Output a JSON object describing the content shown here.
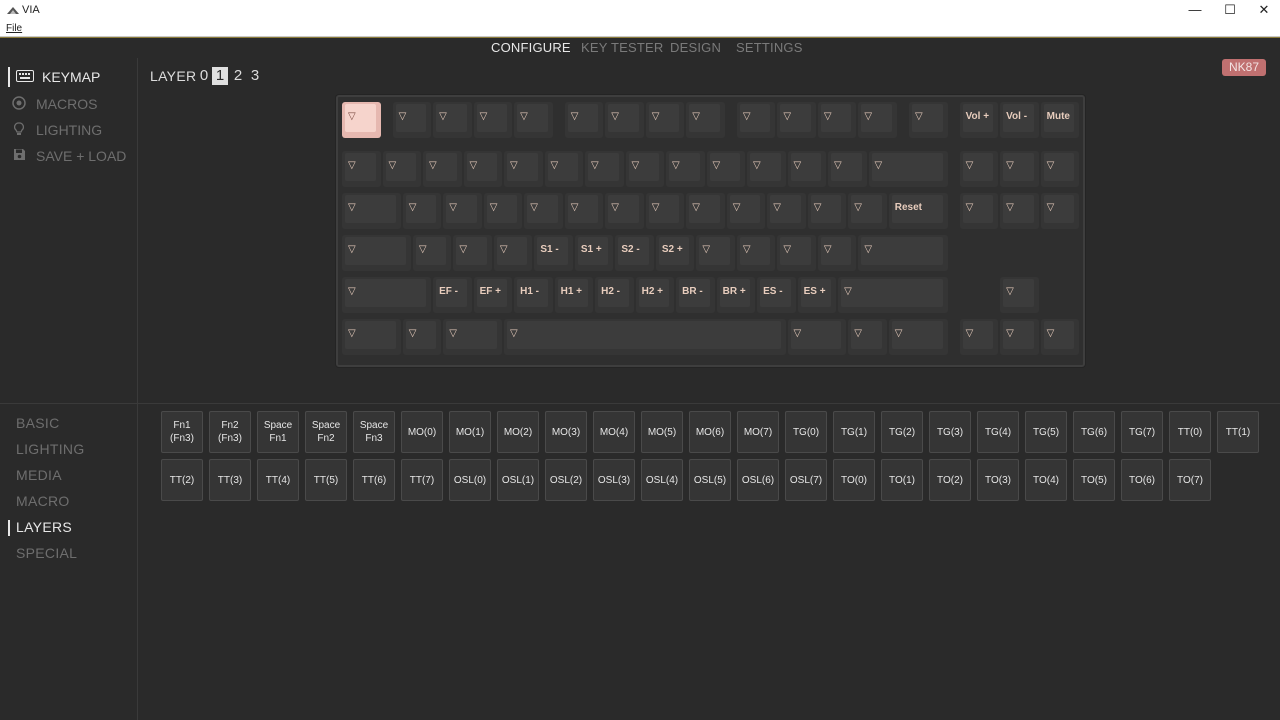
{
  "window": {
    "title": "VIA",
    "minimize": "—",
    "maximize": "☐",
    "close": "✕"
  },
  "menu": {
    "file": "File"
  },
  "topnav": {
    "tabs": [
      "CONFIGURE",
      "KEY TESTER",
      "DESIGN",
      "SETTINGS"
    ],
    "active": 0
  },
  "sidebar": {
    "items": [
      {
        "label": "KEYMAP",
        "icon": "keyboard-icon"
      },
      {
        "label": "MACROS",
        "icon": "macro-circle-icon"
      },
      {
        "label": "LIGHTING",
        "icon": "lightbulb-icon"
      },
      {
        "label": "SAVE + LOAD",
        "icon": "floppy-disk-icon"
      }
    ],
    "active": 0
  },
  "layer": {
    "label": "LAYER",
    "numbers": [
      "0",
      "1",
      "2",
      "3"
    ],
    "active": 1
  },
  "device_badge": "NK87",
  "keyboard": {
    "glyph": "▽",
    "rows": [
      [
        "▽",
        "▽",
        "▽",
        "▽",
        "▽",
        "▽",
        "▽",
        "▽",
        "▽",
        "▽",
        "▽",
        "▽",
        "▽",
        "▽",
        "Vol +",
        "Vol -",
        "Mute"
      ],
      [
        "▽",
        "▽",
        "▽",
        "▽",
        "▽",
        "▽",
        "▽",
        "▽",
        "▽",
        "▽",
        "▽",
        "▽",
        "▽",
        "▽",
        "▽",
        "▽",
        "▽"
      ],
      [
        "▽",
        "▽",
        "▽",
        "▽",
        "▽",
        "▽",
        "▽",
        "▽",
        "▽",
        "▽",
        "▽",
        "▽",
        "▽",
        "Reset",
        "▽",
        "▽",
        "▽"
      ],
      [
        "▽",
        "▽",
        "▽",
        "▽",
        "S1 -",
        "S1 +",
        "S2 -",
        "S2 +",
        "▽",
        "▽",
        "▽",
        "▽",
        "▽"
      ],
      [
        "▽",
        "EF -",
        "EF +",
        "H1 -",
        "H1 +",
        "H2 -",
        "H2 +",
        "BR -",
        "BR +",
        "ES -",
        "ES +",
        "▽",
        "▽"
      ],
      [
        "▽",
        "▽",
        "▽",
        "▽",
        "▽",
        "▽",
        "▽",
        "▽",
        "▽",
        "▽"
      ]
    ]
  },
  "categories": {
    "items": [
      "BASIC",
      "LIGHTING",
      "MEDIA",
      "MACRO",
      "LAYERS",
      "SPECIAL"
    ],
    "active": 4
  },
  "palette_keys": [
    "Fn1\n(Fn3)",
    "Fn2\n(Fn3)",
    "Space\nFn1",
    "Space\nFn2",
    "Space\nFn3",
    "MO(0)",
    "MO(1)",
    "MO(2)",
    "MO(3)",
    "MO(4)",
    "MO(5)",
    "MO(6)",
    "MO(7)",
    "TG(0)",
    "TG(1)",
    "TG(2)",
    "TG(3)",
    "TG(4)",
    "TG(5)",
    "TG(6)",
    "TG(7)",
    "TT(0)",
    "TT(1)",
    "TT(2)",
    "TT(3)",
    "TT(4)",
    "TT(5)",
    "TT(6)",
    "TT(7)",
    "OSL(0)",
    "OSL(1)",
    "OSL(2)",
    "OSL(3)",
    "OSL(4)",
    "OSL(5)",
    "OSL(6)",
    "OSL(7)",
    "TO(0)",
    "TO(1)",
    "TO(2)",
    "TO(3)",
    "TO(4)",
    "TO(5)",
    "TO(6)",
    "TO(7)"
  ]
}
